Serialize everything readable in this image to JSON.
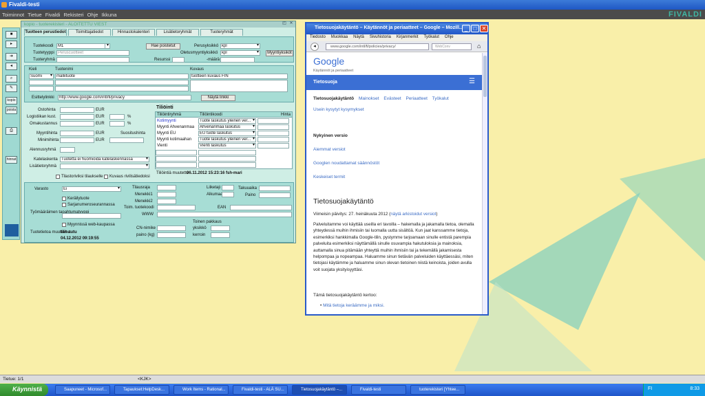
{
  "window": {
    "title": "Fivaldi-testi",
    "brand": "FIVALDI",
    "colors": {
      "titlebar": "#1f57c4",
      "accent": "#3fb7a3",
      "panel": "#a7ddd5",
      "desktop": "#f9efa9"
    }
  },
  "menubar": [
    "Toiminnot",
    "Tietue",
    "Fivaldi",
    "Rekisteri",
    "Ohje",
    "Ikkuna"
  ],
  "left_toolbar": [
    "kopio",
    "poista",
    "hinnat"
  ],
  "erp": {
    "title": "kopio - tuoterekisteri - ALOITETTU VIEST",
    "tabs": [
      "Tuotteen perustiedot",
      "Toimittajatiedot",
      "Hinnastokalenteri",
      "Lisätietoryhmät",
      "Tuoteryhmät"
    ],
    "fields": {
      "tuotekoodi_label": "Tuotekoodi",
      "tuotekoodi": "M1",
      "tuotetyyppi_label": "Tuotetyyppi",
      "tuotetyyppi": "Peruscuotteet",
      "tuoteryhma_label": "Tuoteryhmä",
      "hae_poistetut": "Hae poistetut",
      "resurssi_label": "Resurssi",
      "perusyksikko_label": "Perusyksikkö",
      "perusyksikko": "kpl",
      "oletusmyynti_label": "Oletusmyyntiyksikkö",
      "oletusmyynti": "kpl",
      "maara_label": "-määrä",
      "myyntiyksikot": "Myyntiyksiköt"
    },
    "lang_grid": {
      "headers": [
        "Kieli",
        "Tuotenimi",
        "Kuvaus"
      ],
      "rows": [
        [
          "Suomi",
          "malliituote",
          "tuotteen kuvaus FIN"
        ]
      ]
    },
    "esittelylinkki_label": "Esittelylinkki",
    "esittelylinkki": "http://www.google.com/intl/fi/privacy",
    "nayta_linkki": "Näytä linkki",
    "price_labels": [
      "Ostohinta",
      "Logistiikan kust.",
      "Omakustannus",
      "Myyntihinta",
      "Minimihinta",
      "Alennusryhmä",
      "Katelaskenta",
      "Lisätietoryhmä"
    ],
    "eur": "EUR",
    "pct": "%",
    "suositushinta": "Suositushinta",
    "katelaskenta": "Tuotetta ei huomioida katelaskennassa",
    "tiliointi": {
      "title": "Tiliöinti",
      "headers": [
        "Tiliöintiryhmä",
        "Tiliöintikoodi",
        "Hinta"
      ],
      "rows": [
        [
          "Kotimyynti",
          "Tuote laskutus yleinen ver..."
        ],
        [
          "Myynti Ahvenanmaa",
          "Ahvenanmaa laskutus"
        ],
        [
          "Myynti EU",
          "EU tuote laskutus"
        ],
        [
          "Myynti kotimaahan",
          "Tuote laskutus yleinen ver..."
        ],
        [
          "Vienti",
          "Vienti laskutus"
        ]
      ],
      "muutettu_label": "Tiliöintiä muutettu",
      "muutettu": "06.11.2012 15:23:16 fsh-mari"
    },
    "checks": {
      "tilastorivi": "Tilastoriviksi tilaukselle",
      "kuvaus_rivi": "Kuvaus rivilisätiedoksi"
    },
    "lower": {
      "varasto_label": "Varasto",
      "varasto": "Ei",
      "keraily": "Keräilytuote",
      "sarjanumero": "Sarjanumeroseurannassa",
      "tyomaaraimen": "Työmääräimen tapahtumatyyppi",
      "web": "Myynnissä web-kaupassa",
      "tuotetietoa_label": "Tuotetietoa muuttanut",
      "tuotetietoa": "tilit-autu",
      "muutettu": "04.12.2012 09:19:55",
      "mid_labels": [
        "Tilausraja",
        "Menekki1",
        "Menekki2",
        "Toim. tuotekoodi",
        "WWW",
        "CN-nimike",
        "paino (kg)"
      ],
      "right_labels": [
        "Liiketaji",
        "Alkumaa",
        "EAN"
      ],
      "far_labels": [
        "Takuuaika",
        "Paino"
      ],
      "toinen_label": "Toinen pakkaus",
      "yksikko": "yksikkö",
      "kerroin": "kerroin"
    }
  },
  "browser": {
    "title": "Tietosuojakäytäntö – Käytännöt ja periaatteet – Google – Mozill...",
    "menu": [
      "Tiedosto",
      "Muokkaa",
      "Näytä",
      "Sivuhistoria",
      "Kirjanmerkit",
      "Työkalut",
      "Ohje"
    ],
    "url": "www.google.com/intl/fi/policies/privacy/",
    "search_placeholder": "WebConv",
    "google_logo": "Google",
    "subtitle": "Käytännöt ja periaatteet",
    "bar_title": "Tietosuoja",
    "tabs": [
      "Tietosuojakäytäntö",
      "Mainokset",
      "Evästeet",
      "Periaatteet",
      "Työkalut"
    ],
    "faq": "Usein kysytyt kysymykset",
    "version_head": "Nykyinen versio",
    "links": [
      "Aiemmat versiot",
      "Googlen noudattamat säännöstöt",
      "Keskeiset termit"
    ],
    "heading": "Tietosuojakäytäntö",
    "updated": "Viimeisin päivitys: 27. heinäkuuta 2012 (",
    "updated_link": "näytä arkistoidut versiot",
    "updated_end": ")",
    "body": "Palveluitamme voi käyttää useilla eri tavoilla – hakemalla ja jakamalla tietoa, olemalla yhteydessä muihin ihmisiin tai luomalla uutta sisältöä. Kun jaat kanssamme tietoja, esimerkiksi hankkimalla Google-tilin, pystymme tarjoamaan sinulle entistä parempia palveluita esimerkiksi näyttämällä sinulle osuvampia hakutuloksia ja mainoksia, auttamalla sinua pitämään yhteyttä muihin ihmisiin tai ja tekemällä jakamisesta helpompaa ja nopeampaa. Haluamme sinun tietävän palveluiden käyttäessäsi, miten tietojasi käytämme ja haluamme sinun olevan tietoinen niistä keinoista, joiden avulla voit suojata yksityisyyttäsi.",
    "kertoo": "Tämä tietosuojakäytäntö kertoo:",
    "bullet": "Mitä tietoja keräämme ja miksi."
  },
  "statusbar": {
    "tietue": "Tietue: 1/1",
    "kjk": "<KJK>"
  },
  "taskbar": {
    "start": "Käynnistä",
    "tasks": [
      "Saapuneet - Microsof...",
      "Tapaukset:HelpDesk...",
      "Work Items - Rational...",
      "Fivaldi-testi - ALÄ SU...",
      "Tietosuojakäytäntö –...",
      "Fivaldi-testi",
      "tuoterekisteri [Yhtee..."
    ],
    "lang": "FI",
    "time": "8:33"
  }
}
